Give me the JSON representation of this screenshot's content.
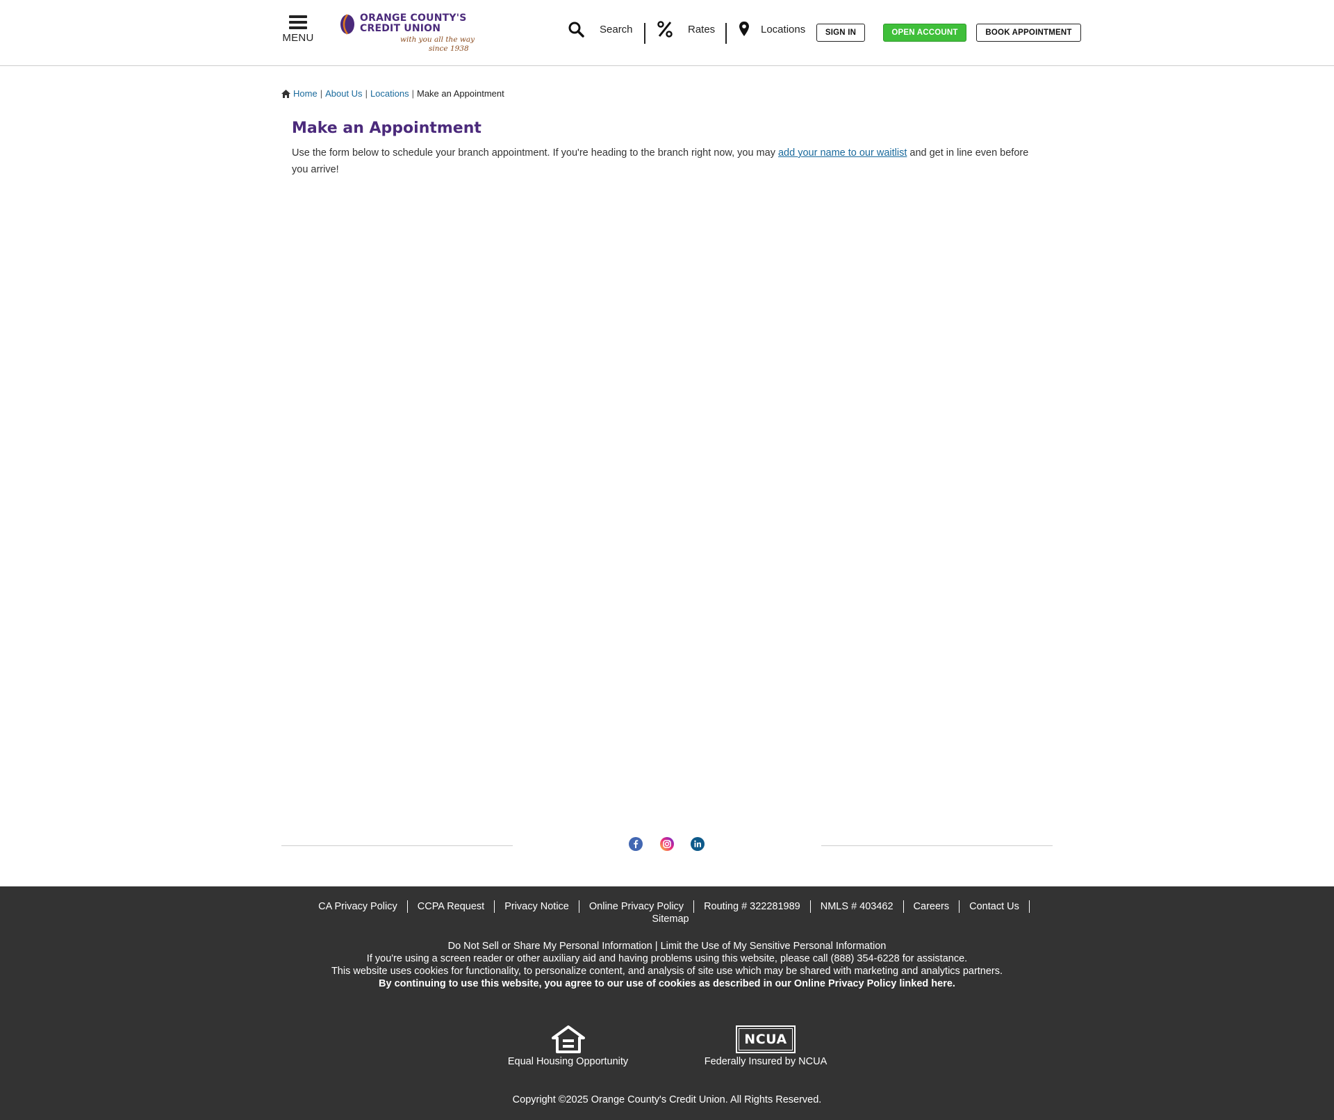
{
  "header": {
    "menu_label": "MENU",
    "logo": {
      "line1": "ORANGE COUNTY'S",
      "line2": "CREDIT UNION",
      "tagline1": "with you all the way",
      "tagline2": "since 1938"
    },
    "nav": {
      "search": "Search",
      "rates": "Rates",
      "locations": "Locations"
    },
    "buttons": {
      "sign_in": "SIGN IN",
      "open_account": "OPEN ACCOUNT",
      "book_appointment": "BOOK APPOINTMENT"
    }
  },
  "breadcrumb": {
    "home": "Home",
    "about": "About Us",
    "locations": "Locations",
    "current": "Make an Appointment",
    "separator": "|"
  },
  "main": {
    "title": "Make an Appointment",
    "intro_before": "Use the form below to schedule your branch appointment. If you're heading to the branch right now, you may ",
    "intro_link": "add your name to our waitlist",
    "intro_after": " and get in line even before you arrive!"
  },
  "social": {
    "facebook": "facebook-icon",
    "instagram": "instagram-icon",
    "linkedin": "linkedin-icon"
  },
  "footer": {
    "links": [
      "CA Privacy Policy",
      "CCPA Request",
      "Privacy Notice",
      "Online Privacy Policy",
      "Routing # 322281989",
      "NMLS # 403462",
      "Careers",
      "Contact Us",
      "Sitemap"
    ],
    "do_not_sell": "Do Not Sell or Share My Personal Information",
    "info_sep": " | ",
    "limit_use": "Limit the Use of My Sensitive Personal Information",
    "screen_reader": "If you're using a screen reader or other auxiliary aid and having problems using this website, please call (888) 354-6228 for assistance.",
    "cookies": "This website uses cookies for functionality, to personalize content, and analysis of site use which may be shared with marketing and analytics partners.",
    "agree": "By continuing to use this website, you agree to our use of cookies as described in our Online Privacy Policy linked here.",
    "equal_housing": "Equal Housing Opportunity",
    "ncua": "Federally Insured by NCUA",
    "ncua_logo": "NCUA",
    "copyright": "Copyright ©2025 Orange County's Credit Union. All Rights Reserved."
  },
  "colors": {
    "brand_purple": "#4b2a7b",
    "link_blue": "#1a6a9c",
    "open_account_green": "#3fbf3a",
    "footer_bg": "#333333"
  }
}
